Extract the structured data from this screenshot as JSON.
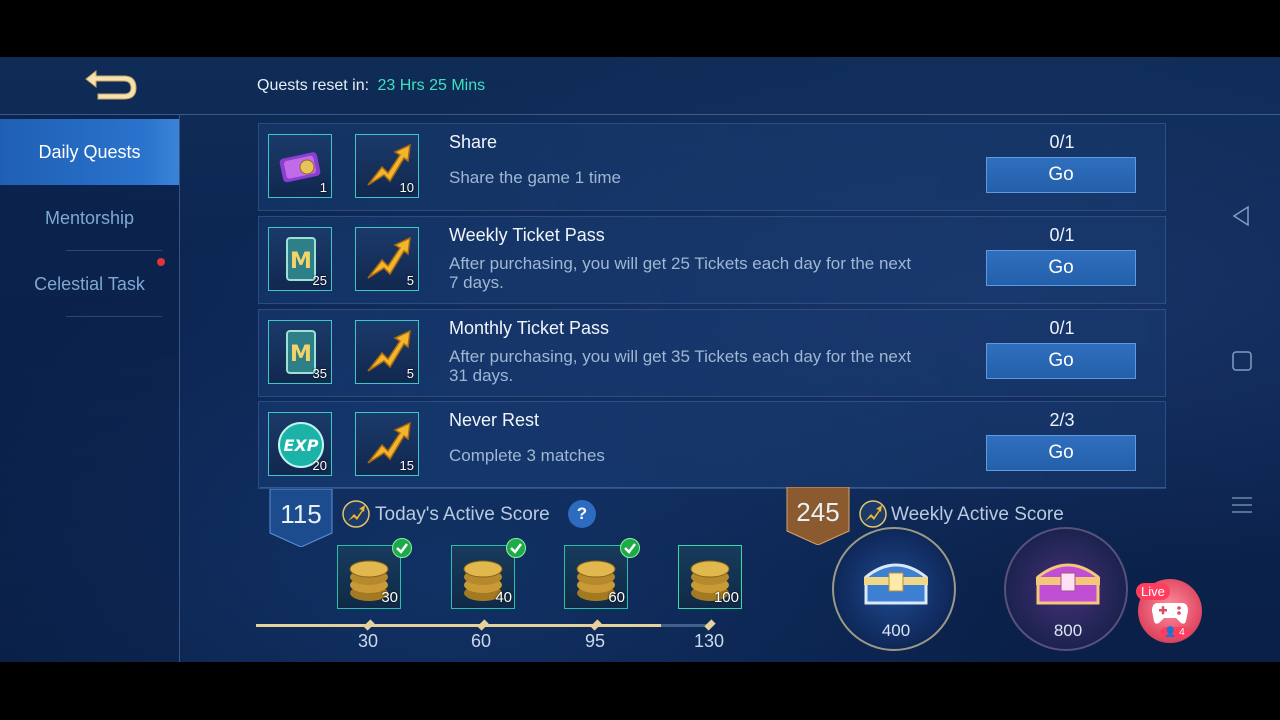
{
  "header": {
    "reset_label": "Quests reset in:",
    "reset_time": "23 Hrs 25 Mins"
  },
  "sidebar": {
    "items": [
      {
        "label": "Daily Quests",
        "active": true
      },
      {
        "label": "Mentorship",
        "active": false
      },
      {
        "label": "Celestial Task",
        "active": false,
        "has_notification": true
      }
    ]
  },
  "quests": [
    {
      "title": "Share",
      "description": "Share the game 1 time",
      "progress": "0/1",
      "button": "Go",
      "rewards": [
        {
          "icon": "ticket-card-icon",
          "count": "1"
        },
        {
          "icon": "activity-arrow-icon",
          "count": "10"
        }
      ]
    },
    {
      "title": "Weekly Ticket Pass",
      "description": "After purchasing, you will get 25 Tickets each day for the next 7 days.",
      "progress": "0/1",
      "button": "Go",
      "rewards": [
        {
          "icon": "m-ticket-icon",
          "count": "25"
        },
        {
          "icon": "activity-arrow-icon",
          "count": "5"
        }
      ]
    },
    {
      "title": "Monthly Ticket Pass",
      "description": "After purchasing, you will get 35 Tickets each day for the next 31 days.",
      "progress": "0/1",
      "button": "Go",
      "rewards": [
        {
          "icon": "m-ticket-icon",
          "count": "35"
        },
        {
          "icon": "activity-arrow-icon",
          "count": "5"
        }
      ]
    },
    {
      "title": "Never Rest",
      "description": "Complete 3 matches",
      "progress": "2/3",
      "button": "Go",
      "rewards": [
        {
          "icon": "exp-icon",
          "count": "20"
        },
        {
          "icon": "activity-arrow-icon",
          "count": "15"
        }
      ]
    }
  ],
  "daily_score": {
    "value": "115",
    "label": "Today's Active Score",
    "help": "?",
    "milestones": [
      {
        "threshold": "30",
        "reward": "30",
        "claimed": true
      },
      {
        "threshold": "60",
        "reward": "40",
        "claimed": true
      },
      {
        "threshold": "95",
        "reward": "60",
        "claimed": true
      },
      {
        "threshold": "130",
        "reward": "100",
        "claimed": false
      }
    ],
    "progress_fraction": 0.89
  },
  "weekly_score": {
    "value": "245",
    "label": "Weekly Active Score",
    "chests": [
      {
        "threshold": "400",
        "icon": "silver-chest-icon"
      },
      {
        "threshold": "800",
        "icon": "purple-chest-icon"
      }
    ]
  },
  "live": {
    "tag": "Live",
    "viewers": "4"
  },
  "colors": {
    "accent_teal": "#3fe0c0",
    "button_blue": "#2f6fbe",
    "active_tab": "#2a73cc"
  }
}
